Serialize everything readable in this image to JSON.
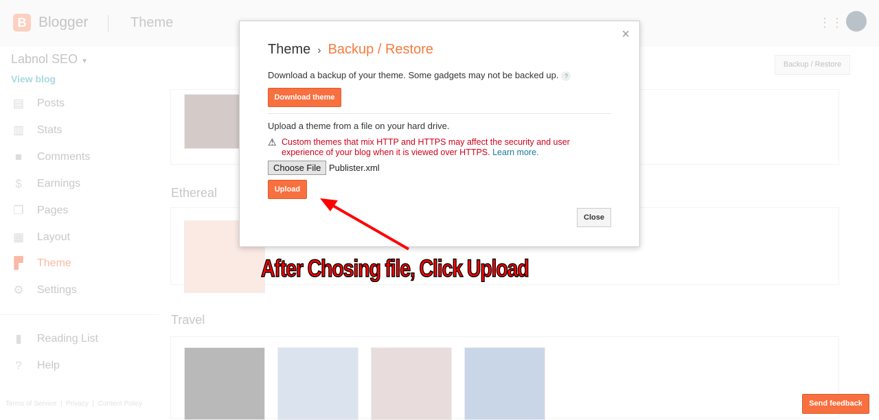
{
  "header": {
    "brand": "Blogger",
    "section": "Theme",
    "logo_letter": "B"
  },
  "sidebar": {
    "blog_name": "Labnol SEO",
    "view_blog": "View blog",
    "items": [
      {
        "label": "Posts",
        "icon": "posts-icon"
      },
      {
        "label": "Stats",
        "icon": "stats-icon"
      },
      {
        "label": "Comments",
        "icon": "comments-icon"
      },
      {
        "label": "Earnings",
        "icon": "dollar-icon"
      },
      {
        "label": "Pages",
        "icon": "pages-icon"
      },
      {
        "label": "Layout",
        "icon": "layout-icon"
      },
      {
        "label": "Theme",
        "icon": "paint-roller-icon",
        "active": true
      },
      {
        "label": "Settings",
        "icon": "gear-icon"
      }
    ],
    "secondary": [
      {
        "label": "Reading List",
        "icon": "bookmark-icon"
      },
      {
        "label": "Help",
        "icon": "help-icon"
      }
    ],
    "footer": [
      "Terms of Service",
      "Privacy",
      "Content Policy"
    ]
  },
  "main": {
    "backup_button": "Backup / Restore",
    "sections": [
      "Ethereal",
      "Travel"
    ]
  },
  "dialog": {
    "breadcrumb_root": "Theme",
    "breadcrumb_sep": "›",
    "title": "Backup / Restore",
    "download_text": "Download a backup of your theme. Some gadgets may not be backed up.",
    "help": "?",
    "download_button": "Download theme",
    "upload_text": "Upload a theme from a file on your hard drive.",
    "warning": "Custom themes that mix HTTP and HTTPS may affect the security and user experience of your blog when it is viewed over HTTPS.",
    "learn_more": "Learn more.",
    "choose_file": "Choose File",
    "file_name": "Publister.xml",
    "upload_button": "Upload",
    "close_button": "Close",
    "close_x": "×"
  },
  "annotation": "After Chosing file, Click Upload",
  "feedback": "Send feedback",
  "colors": {
    "accent": "#f8703f",
    "annotation": "#ff0000",
    "warning": "#d0021b"
  }
}
